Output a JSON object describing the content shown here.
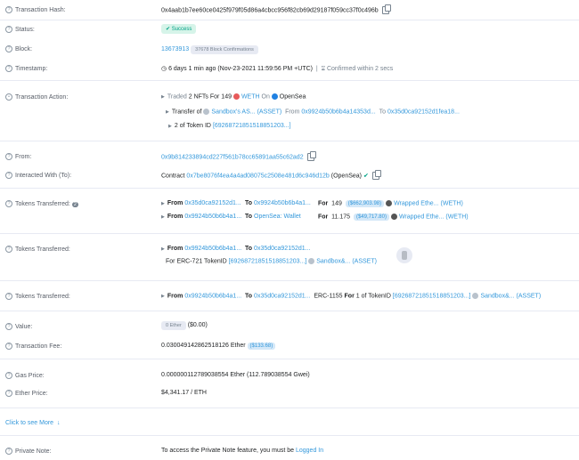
{
  "tx": {
    "hash_label": "Transaction Hash:",
    "hash": "0x4aab1b7ee60ce0425f979f05d86a4cbcc956f82cb69d29187f059cc37f0c496b",
    "status_label": "Status:",
    "status": "Success",
    "block_label": "Block:",
    "block": "13673913",
    "confirmations": "37678 Block Confirmations",
    "timestamp_label": "Timestamp:",
    "timestamp": "6 days 1 min ago (Nov-23-2021 11:59:56 PM +UTC)",
    "confirmed": "Confirmed within 2 secs",
    "action_label": "Transaction Action:",
    "action_line1_a": "Traded",
    "action_line1_b": "2 NFTs",
    "action_line1_c": "For 149",
    "action_weth": "WETH",
    "action_on": "On",
    "action_market": "OpenSea",
    "action_line2_a": "Transfer of",
    "action_line2_asset": "Sandbox's AS...",
    "action_line2_asset_type": "(ASSET)",
    "action_line2_from": "From",
    "action_line2_from_addr": "0x9924b50b6b4a14353d...",
    "action_line2_to": "To",
    "action_line2_to_addr": "0x35d0ca92152d1fea18...",
    "action_line3_a": "2 of Token ID",
    "action_line3_token": "[69268721851518851203...]",
    "from_label": "From:",
    "from": "0x9b814233894cd227f561b78cc65891aa55c62ad2",
    "to_label": "Interacted With (To):",
    "to_prefix": "Contract",
    "to_addr": "0x7be8076f4ea4a4ad08075c2508e481d6c946d12b",
    "to_name": "(OpenSea)",
    "tt_label": "Tokens Transferred:",
    "tt_count": "2",
    "tt1_from_addr": "0x35d0ca92152d1...",
    "tt1_to_addr": "0x9924b50b6b4a1...",
    "tt1_amount": "149",
    "tt1_usd": "($662,903.98)",
    "tt1_token": "Wrapped Ethe...",
    "tt1_sym": "(WETH)",
    "tt2_from_addr": "0x9924b50b6b4a1...",
    "tt2_to_addr": "OpenSea: Wallet",
    "tt2_amount": "11.175",
    "tt2_usd": "($49,717.80)",
    "tt2_token": "Wrapped Ethe...",
    "tt2_sym": "(WETH)",
    "nft_label": "Tokens Transferred:",
    "nft_from_addr": "0x9924b50b6b4a1...",
    "nft_to_addr": "0x35d0ca92152d1...",
    "nft_for": "For ERC-721 TokenID",
    "nft_token": "[69268721851518851203...]",
    "nft_asset": "Sandbox&...",
    "nft_asset_type": "(ASSET)",
    "nft2_label": "Tokens Transferred:",
    "nft2_from_addr": "0x9924b50b6b4a1...",
    "nft2_to_addr": "0x35d0ca92152d1...",
    "nft2_std": "ERC-1155",
    "nft2_for": "For",
    "nft2_qty": "1 of TokenID",
    "nft2_token": "[69268721851518851203...]",
    "nft2_asset": "Sandbox&...",
    "nft2_asset_type": "(ASSET)",
    "value_label": "Value:",
    "value_badge": "0 Ether",
    "value_usd": "($0.00)",
    "fee_label": "Transaction Fee:",
    "fee": "0.030049142862518126 Ether",
    "fee_usd": "($133.68)",
    "gas_label": "Gas Price:",
    "gas": "0.000000112789038554 Ether (112.789038554 Gwei)",
    "ether_label": "Ether Price:",
    "ether": "$4,341.17 / ETH",
    "see_more": "Click to see More",
    "note_label": "Private Note:",
    "note_text": "To access the Private Note feature, you must be",
    "note_link": "Logged In",
    "kw_from": "From",
    "kw_to": "To",
    "kw_for": "For"
  },
  "colors": {
    "link": "#3498db",
    "success": "#00a186",
    "label": "#555b65"
  }
}
